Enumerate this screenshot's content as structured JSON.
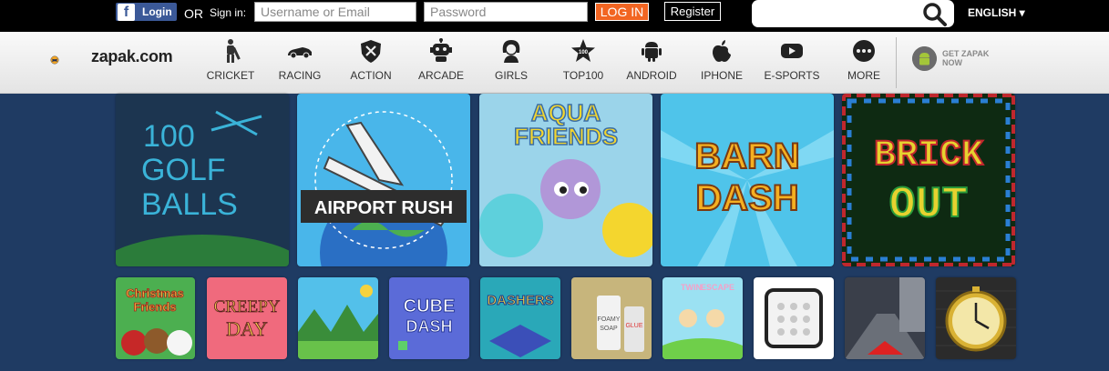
{
  "topbar": {
    "facebook_icon": "facebook-f-icon",
    "facebook_login_label": "Login",
    "or_text": "OR",
    "signin_label": "Sign in:",
    "username_placeholder": "Username or Email",
    "password_placeholder": "Password",
    "login_button": "LOG IN",
    "register_button": "Register",
    "search_icon": "search-icon",
    "language": "ENGLISH ▾"
  },
  "brand": {
    "logo_text": "zapak.com"
  },
  "nav": {
    "items": [
      {
        "label": "CRICKET",
        "icon": "cricket-icon"
      },
      {
        "label": "RACING",
        "icon": "car-icon"
      },
      {
        "label": "ACTION",
        "icon": "shield-icon"
      },
      {
        "label": "ARCADE",
        "icon": "robot-icon"
      },
      {
        "label": "GIRLS",
        "icon": "girl-icon"
      },
      {
        "label": "TOP100",
        "icon": "star-icon"
      },
      {
        "label": "ANDROID",
        "icon": "android-icon"
      },
      {
        "label": "IPHONE",
        "icon": "apple-icon"
      },
      {
        "label": "E-SPORTS",
        "icon": "play-icon"
      },
      {
        "label": "MORE",
        "icon": "more-icon"
      }
    ],
    "get_app": "GET ZAPAK NOW"
  },
  "featured_games": [
    {
      "title_lines": [
        "100",
        "GOLF",
        "BALLS"
      ],
      "bg": "#1e3a55"
    },
    {
      "title": "AIRPORT RUSH",
      "bg": "#49b6ea"
    },
    {
      "title_lines": [
        "AQUA",
        "FRIENDS"
      ],
      "bg": "#9bd4ea"
    },
    {
      "title_lines": [
        "BARN",
        "DASH"
      ],
      "bg": "#4fc4ea"
    },
    {
      "title_lines": [
        "BRICK",
        "OUT"
      ],
      "bg": "#0e2a12"
    }
  ],
  "small_games": [
    {
      "title_lines": [
        "Christmas",
        "Friends"
      ]
    },
    {
      "title_lines": [
        "CREEPY",
        "DAY"
      ]
    },
    {
      "title_lines": []
    },
    {
      "title_lines": [
        "CUBE",
        "DASH"
      ]
    },
    {
      "title_lines": [
        "DASHERS"
      ]
    },
    {
      "title_lines": [
        "FOAMY",
        "SOAP",
        "GLUE"
      ]
    },
    {
      "title_lines": [
        "TWIN",
        "ESCAPE"
      ]
    },
    {
      "title_lines": []
    },
    {
      "title_lines": []
    },
    {
      "title_lines": []
    }
  ]
}
